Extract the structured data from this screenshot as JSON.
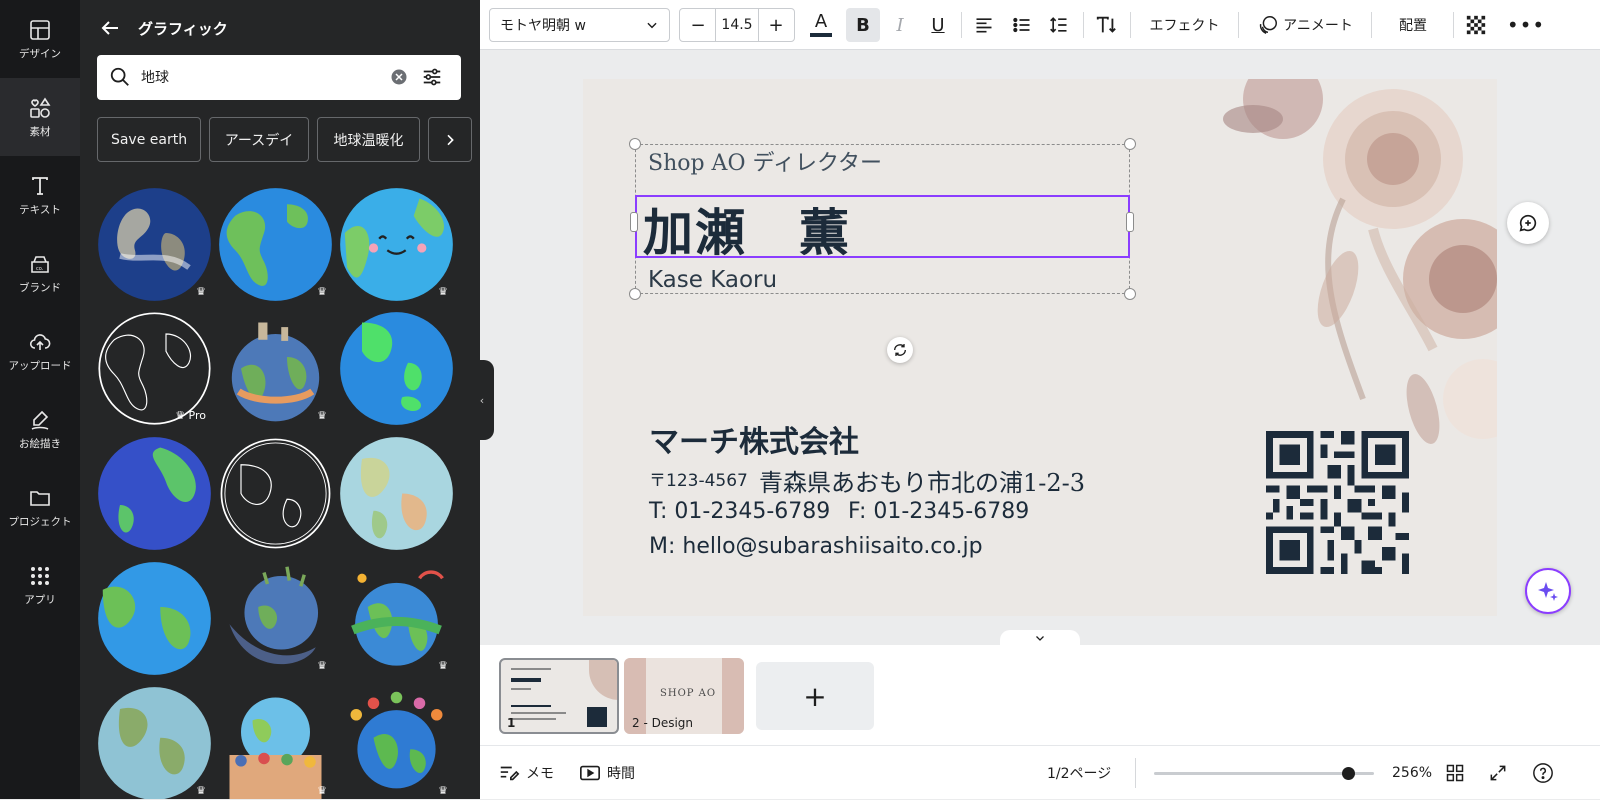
{
  "rail": {
    "items": [
      {
        "label": "デザイン",
        "icon": "layout-icon"
      },
      {
        "label": "素材",
        "icon": "shapes-icon"
      },
      {
        "label": "テキスト",
        "icon": "text-icon"
      },
      {
        "label": "ブランド",
        "icon": "brand-icon"
      },
      {
        "label": "アップロード",
        "icon": "upload-icon"
      },
      {
        "label": "お絵描き",
        "icon": "draw-icon"
      },
      {
        "label": "プロジェクト",
        "icon": "folder-icon"
      },
      {
        "label": "アプリ",
        "icon": "apps-icon"
      }
    ],
    "active_index": 1
  },
  "panel": {
    "title": "グラフィック",
    "search_value": "地球",
    "chips": [
      "Save earth",
      "アースデイ",
      "地球温暖化"
    ],
    "pro_badge": "Pro"
  },
  "toolbar": {
    "font_name": "モトヤ明朝 w",
    "font_size": "14.5",
    "minus": "−",
    "plus": "+",
    "effects": "エフェクト",
    "animate": "アニメート",
    "position": "配置"
  },
  "card": {
    "role": "Shop AO ディレクター",
    "name": "加瀬　薫",
    "name_romaji": "Kase Kaoru",
    "company": "マーチ株式会社",
    "postal": "〒123-4567",
    "address": "青森県あおもり市北の浦1-2-3",
    "tel": "T: 01-2345-6789",
    "fax": "F: 01-2345-6789",
    "mail": "M: hello@subarashiisaito.co.jp"
  },
  "pages": {
    "page1_number": "1",
    "page2_label": "2 - Design",
    "page2_title": "SHOP AO",
    "add": "+"
  },
  "bottombar": {
    "notes": "メモ",
    "timer": "時間",
    "page_indicator": "1/2ページ",
    "zoom": "256%",
    "zoom_level": 0.88
  },
  "colors": {
    "accent": "#8b3dff",
    "text_dark": "#1c2b3a",
    "panel_bg": "#252627",
    "rail_bg": "#18191b"
  }
}
